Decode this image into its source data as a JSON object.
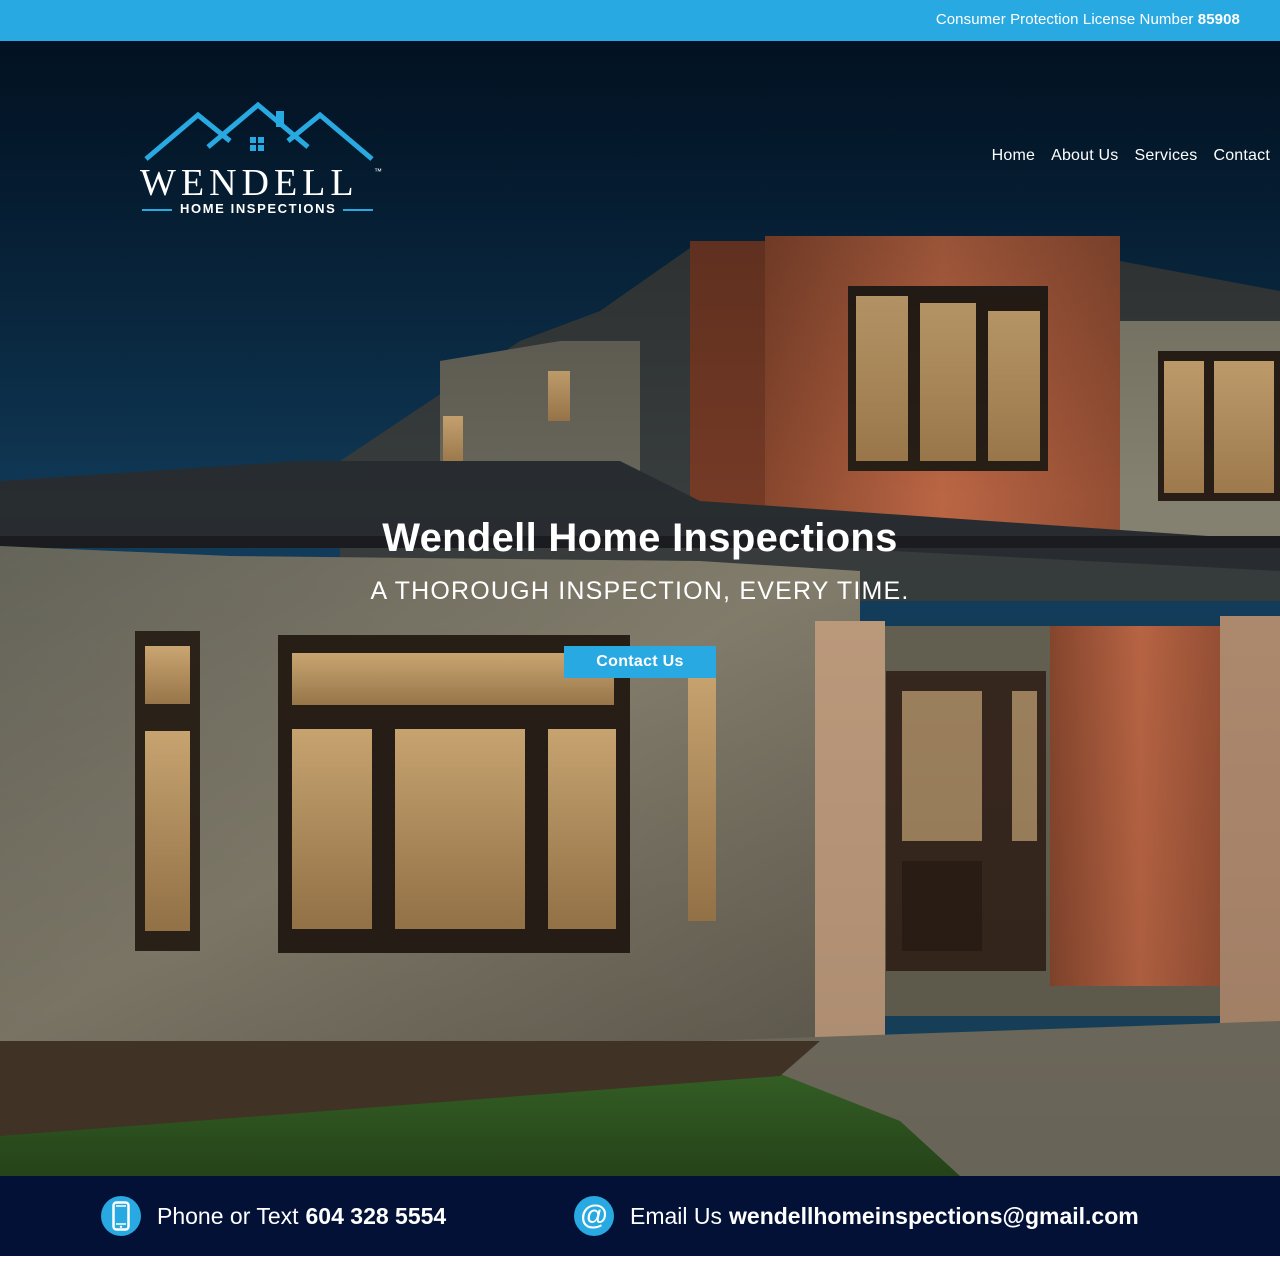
{
  "topbar": {
    "license_label": "Consumer Protection License Number",
    "license_number": "85908"
  },
  "logo": {
    "wordmark": "WENDELL",
    "trademark": "™",
    "subtitle": "HOME INSPECTIONS"
  },
  "nav": {
    "items": [
      {
        "label": "Home"
      },
      {
        "label": "About Us"
      },
      {
        "label": "Services"
      },
      {
        "label": "Contact"
      }
    ]
  },
  "hero": {
    "title": "Wendell Home Inspections",
    "subtitle": "A THOROUGH INSPECTION, EVERY TIME.",
    "cta_label": "Contact Us"
  },
  "contact": {
    "phone_label": "Phone or Text",
    "phone_number": "604 328 5554",
    "email_label": "Email Us",
    "email_address": "wendellhomeinspections@gmail.com",
    "phone_icon": "smartphone-icon",
    "email_icon": "at-sign-icon"
  },
  "colors": {
    "accent": "#29a9e1",
    "strip_background": "#031137",
    "hero_sky": "#0f2c44"
  }
}
